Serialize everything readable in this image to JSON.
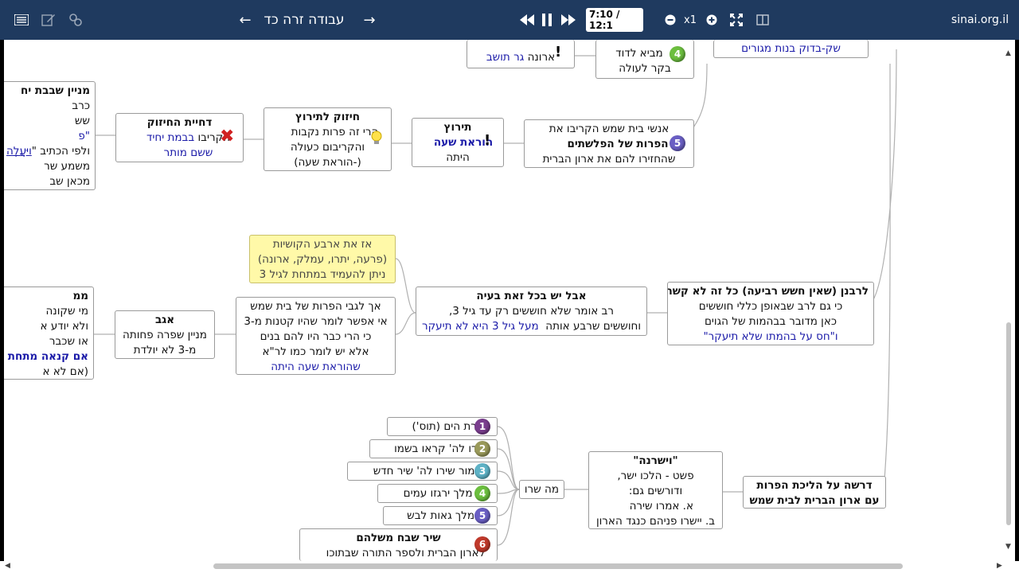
{
  "toolbar": {
    "title": "עבודה זרה כד",
    "prev_arrow": "←",
    "next_arrow": "→",
    "time": "7:10 / 12:1",
    "zoom": "x1",
    "site": "sinai.org.il"
  },
  "nodes": {
    "n_aron_ger": {
      "line1": "ארונה",
      "line2_blue": "גר תושב"
    },
    "n_david": {
      "line1": "מביא לדוד",
      "line2": "בקר לעולה"
    },
    "n_top_right": {
      "text": "שק-בדוק בנות מגורים"
    },
    "n_dchiat": {
      "title": "דחיית החיזוק",
      "line1_black": "הקריבו",
      "line1_blue": "בבמת יחיד",
      "line2_blue": "ששם מותר"
    },
    "n_chizuk": {
      "title": "חיזוק לתירוץ",
      "line1": "הרי זה פרות נקבות",
      "line2": "והקריבום כעולה",
      "line3": "(-הוראת שעה)"
    },
    "n_tirutz": {
      "title": "תירוץ",
      "line1_blue": "הוראת שעה",
      "line2": "היתה"
    },
    "n_beit_shemesh": {
      "line1": "אנשי בית שמש הקריבו את",
      "line2": "הפרות של הפלשתים",
      "line3": "שהחזירו להם את ארון הברית"
    },
    "n_left_top": {
      "title": "מניין שבבת יח",
      "l1": "כרב",
      "l2": "שש",
      "l3": "\"פ",
      "l4a": "ולפי הכתיב \"",
      "l4b": "וַיַּעֲלֶה",
      "l5": "משמע שר",
      "l6": "מכאן שב"
    },
    "n_yellow": {
      "line1": "אז את ארבע הקושיות",
      "line2": "(פרעה, יתרו, עמלק, ארונה)",
      "line3": "ניתן להעמיד במתחת לגיל 3"
    },
    "n_aval": {
      "title": "אבל יש בכל זאת בעיה",
      "line1": "רב אומר שלא חוששים רק עד גיל 3,",
      "line2_black": "וחוששים שרבע אותה",
      "line2_blue": "מעל גיל 3 היא לא תיעקר"
    },
    "n_lerabanan": {
      "title": "לרבנן (שאין חשש רביעה) כל זה לא קשה",
      "line1": "כי גם לרב שבאופן כללי חוששים",
      "line2": "כאן מדובר בבהמות של הגוים",
      "line3": "ו\"חס על בהמתו שלא תיעקר\""
    },
    "n_ach": {
      "line1": "אך לגבי הפרות של בית שמש",
      "line2": "אי אפשר לומר שהיו קטנות מ-3",
      "line3": "כי הרי כבר היו להם בנים",
      "line4": "אלא יש לומר כמו לר\"א",
      "line5_blue": "שהוראת שעה היתה"
    },
    "n_agav": {
      "title": "אגב",
      "line1": "מניין שפרה פחותה",
      "line2": "מ-3 לא יולדת"
    },
    "n_left_mid": {
      "title": "ממ",
      "l1": "מי שקונה",
      "l2": "ולא יודע א",
      "l3": "או שכבר",
      "l4_blue": "אם קנאה מתחת",
      "l5": "(אם לא א"
    },
    "n_drasha": {
      "line1": "דרשה על הליכת הפרות",
      "line2": "עם ארון הברית לבית שמש"
    },
    "n_vayisharna": {
      "title": "\"וישרנה\"",
      "line1": "פשט - הלכו ישר,",
      "line2": "ודורשים גם:",
      "line3": "א. אמרו שירה",
      "line4": "ב. יישרו פניהם כנגד הארון"
    },
    "n_ma_sharu": {
      "text": "מה שרו"
    },
    "songs": [
      {
        "num": "1",
        "color": "#7a3e8e",
        "text": "שירת הים (תוס')"
      },
      {
        "num": "2",
        "color": "#9a9a5a",
        "text": "הודו לה' קראו בשמו"
      },
      {
        "num": "3",
        "color": "#5fb3c7",
        "text": "מזמור שירו לה' שיר חדש"
      },
      {
        "num": "4",
        "color": "#6cbf3f",
        "text": "ה' מלך ירגזו עמים"
      },
      {
        "num": "5",
        "color": "#6a5fc4",
        "text": "ה' מלך גאות לבש"
      }
    ],
    "song6": {
      "num": "6",
      "color": "#c0392b",
      "title": "שיר שבח משלהם",
      "line1": "לארון הברית ולספר התורה שבתוכו"
    },
    "badge4": {
      "num": "4",
      "color": "#6cbf3f"
    },
    "badge5": {
      "num": "5",
      "color": "#6a5fc4"
    }
  }
}
